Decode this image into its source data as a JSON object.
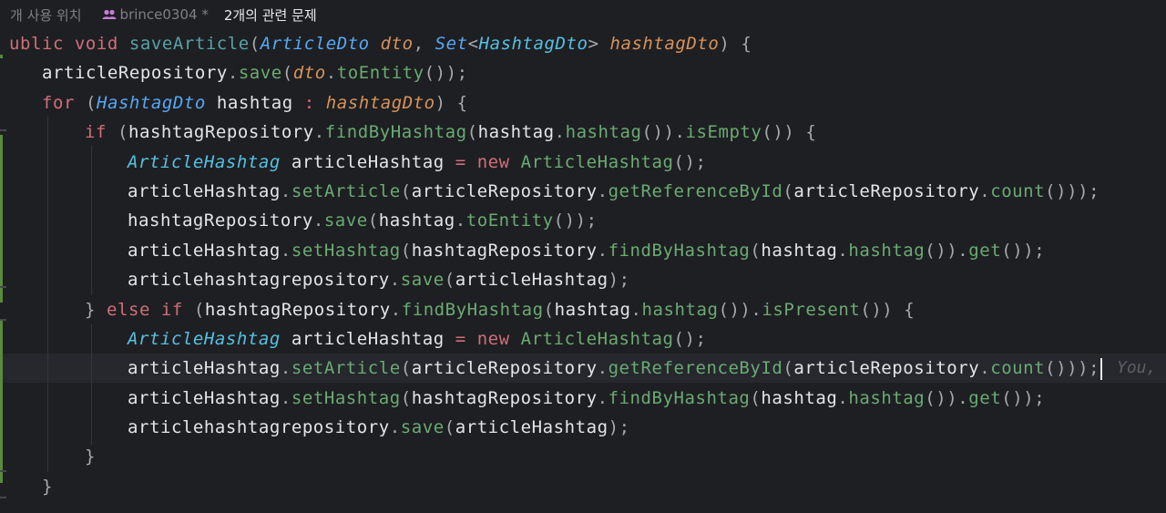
{
  "inlay_header": {
    "usages": "개 사용 위치",
    "author": "brince0304 *",
    "problems": "2개의 관련 문제"
  },
  "code_lines": [
    [
      "ublic void saveArticle(ArticleDto dto, Set<HashtagDto> hashtagDto) {"
    ],
    [
      "articleRepository.save(dto.toEntity());"
    ],
    [
      "for (HashtagDto hashtag : hashtagDto) {"
    ],
    [
      "if (hashtagRepository.findByHashtag(hashtag.hashtag()).isEmpty()) {"
    ],
    [
      "ArticleHashtag articleHashtag = new ArticleHashtag();"
    ],
    [
      "articleHashtag.setArticle(articleRepository.getReferenceById(articleRepository.count()));"
    ],
    [
      "hashtagRepository.save(hashtag.toEntity());"
    ],
    [
      "articleHashtag.setHashtag(hashtagRepository.findByHashtag(hashtag.hashtag()).get());"
    ],
    [
      "articlehashtagrepository.save(articleHashtag);"
    ],
    [
      "} else if (hashtagRepository.findByHashtag(hashtag.hashtag()).isPresent()) {"
    ],
    [
      "ArticleHashtag articleHashtag = new ArticleHashtag();"
    ],
    [
      "articleHashtag.setArticle(articleRepository.getReferenceById(articleRepository.count()));"
    ],
    [
      "articleHashtag.setHashtag(hashtagRepository.findByHashtag(hashtag.hashtag()).get());"
    ],
    [
      "articlehashtagrepository.save(articleHashtag);"
    ],
    [
      "}"
    ],
    [
      "}"
    ]
  ],
  "inline_author_hint": "You,",
  "colors": {
    "background": "#1e1f22",
    "keyword": "#cf6f79",
    "type": "#56a8f5",
    "method": "#6aab73",
    "parameter": "#d6935c",
    "text": "#e3e5e9",
    "vcs_added": "#5b8a3a"
  },
  "icons": {
    "author": "people-icon"
  }
}
